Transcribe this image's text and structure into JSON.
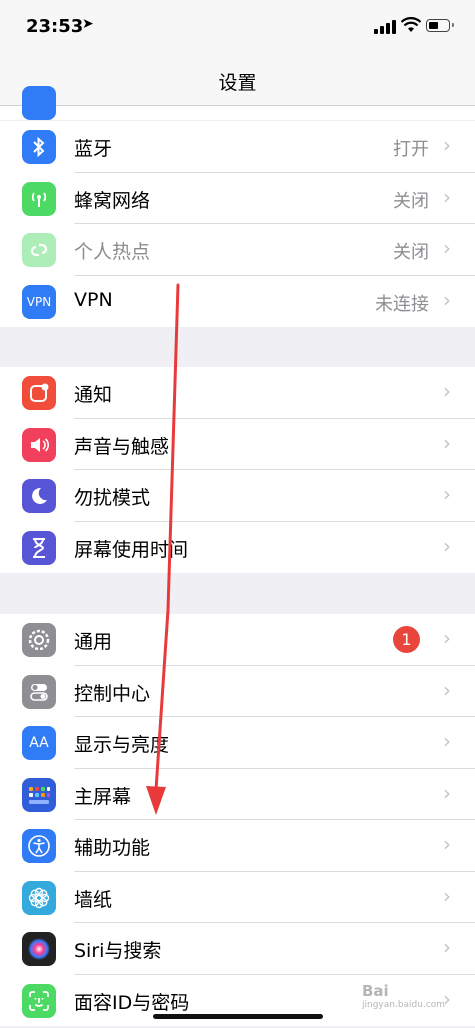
{
  "status_bar": {
    "time": "23:53"
  },
  "nav": {
    "title": "设置"
  },
  "groups": [
    [
      {
        "label": "蓝牙",
        "value": "打开",
        "icon": "bluetooth-icon",
        "color": "#2f7cf6"
      },
      {
        "label": "蜂窝网络",
        "value": "关闭",
        "icon": "cellular-icon",
        "color": "#4cd964"
      },
      {
        "label": "个人热点",
        "value": "关闭",
        "icon": "hotspot-icon",
        "color": "#4cd964",
        "disabled": true
      },
      {
        "label": "VPN",
        "value": "未连接",
        "icon": "vpn-icon",
        "color": "#2f7cf6",
        "icon_text": "VPN"
      }
    ],
    [
      {
        "label": "通知",
        "icon": "notifications-icon",
        "color": "#f04d3a"
      },
      {
        "label": "声音与触感",
        "icon": "sound-icon",
        "color": "#f0405c"
      },
      {
        "label": "勿扰模式",
        "icon": "moon-icon",
        "color": "#5856d6"
      },
      {
        "label": "屏幕使用时间",
        "icon": "hourglass-icon",
        "color": "#5856d6"
      }
    ],
    [
      {
        "label": "通用",
        "icon": "gear-icon",
        "color": "#8e8e93",
        "badge": "1"
      },
      {
        "label": "控制中心",
        "icon": "toggles-icon",
        "color": "#8e8e93"
      },
      {
        "label": "显示与亮度",
        "icon": "display-icon",
        "color": "#2f7cf6",
        "icon_text": "AA"
      },
      {
        "label": "主屏幕",
        "icon": "home-screen-icon",
        "color": "#2f5ed8"
      },
      {
        "label": "辅助功能",
        "icon": "accessibility-icon",
        "color": "#2f7cf6"
      },
      {
        "label": "墙纸",
        "icon": "wallpaper-icon",
        "color": "#34aadc"
      },
      {
        "label": "Siri与搜索",
        "icon": "siri-icon",
        "color": "#222222"
      },
      {
        "label": "面容ID与密码",
        "icon": "faceid-icon",
        "color": "#4cd964"
      }
    ]
  ],
  "watermark": {
    "brand": "Bai",
    "site": "jingyan.baidu.com"
  }
}
